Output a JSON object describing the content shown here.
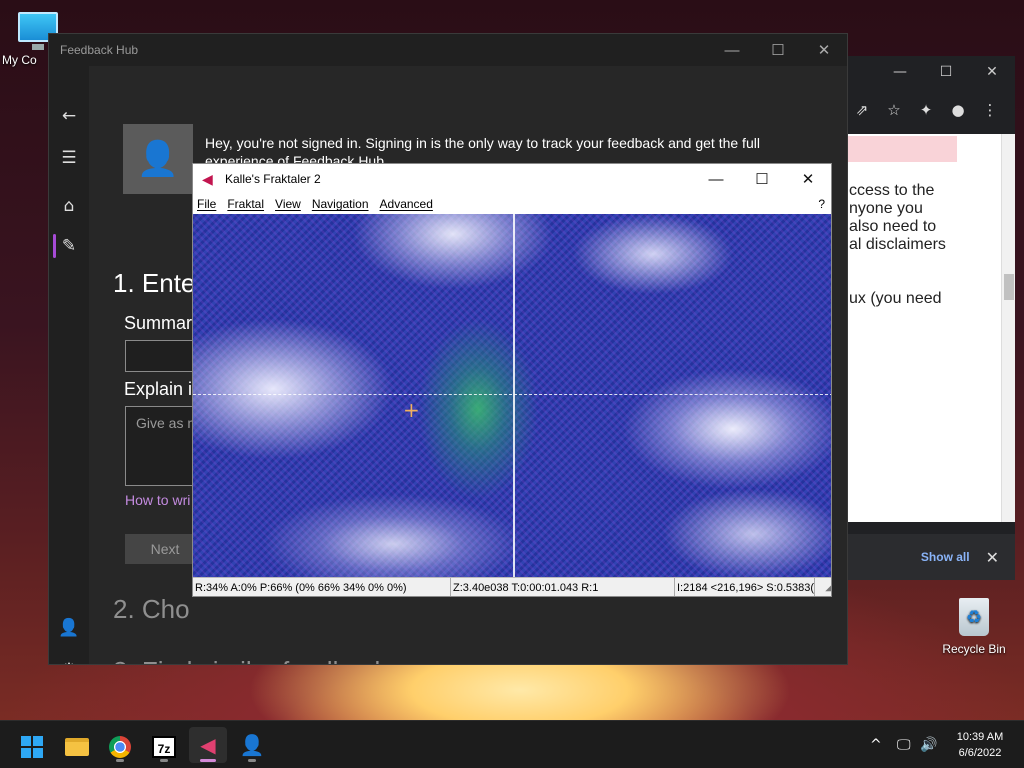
{
  "desktop": {
    "icons": [
      {
        "label": "My Co",
        "icon": "computer-icon"
      },
      {
        "label": "Recycle Bin",
        "icon": "recycle-bin-icon"
      }
    ]
  },
  "browser": {
    "controls": {
      "minimize": "—",
      "maximize": "☐",
      "close": "✕"
    },
    "toolbar": {
      "share": "⇗",
      "bookmark": "☆",
      "extensions": "✦",
      "profile": "●",
      "menu": "⋮"
    },
    "page_lines": [
      "ccess to the",
      "nyone you",
      "also need to",
      "al disclaimers",
      "",
      "",
      "ux (you need"
    ],
    "downloads": {
      "show_all": "Show all",
      "close": "✕"
    }
  },
  "feedback_hub": {
    "title": "Feedback Hub",
    "controls": {
      "minimize": "—",
      "maximize": "☐",
      "close": "✕"
    },
    "nav": {
      "back": "←",
      "menu": "☰",
      "home": "⌂",
      "feedback": "✎",
      "account": "👤",
      "settings": "⚙"
    },
    "signin": {
      "avatar": "👤",
      "message": "Hey, you're not signed in. Signing in is the only way to track your feedback and get the full experience of Feedback Hub."
    },
    "steps": {
      "step1": "1. Ente",
      "step2": "2. Cho",
      "step3": "3. Find similar feedback"
    },
    "summary_label": "Summari",
    "summary_value": "",
    "explain_label": "Explain in",
    "explain_placeholder": "Give as m",
    "how_to_link": "How to wri",
    "next_button": "Next"
  },
  "kalles_fraktaler": {
    "title": "Kalle's Fraktaler 2",
    "app_icon": "◀",
    "controls": {
      "minimize": "—",
      "maximize": "☐",
      "close": "✕"
    },
    "menu": [
      "File",
      "Fraktal",
      "View",
      "Navigation",
      "Advanced"
    ],
    "help": "?",
    "cursor": "+",
    "status": {
      "left": "R:34% A:0% P:66% (0% 66% 34% 0% 0%)",
      "middle": "Z:3.40e038 T:0:00:01.043 R:1",
      "right": "I:2184 <216,196> S:0.5383("
    },
    "grip": "◢"
  },
  "taskbar": {
    "items": [
      "start",
      "file-explorer",
      "chrome",
      "7zip",
      "kalles-fraktaler",
      "feedback-hub"
    ],
    "tray": {
      "chevron": "^",
      "network": "🖵",
      "volume": "🔊"
    },
    "clock": {
      "time": "10:39 AM",
      "date": "6/6/2022"
    }
  }
}
